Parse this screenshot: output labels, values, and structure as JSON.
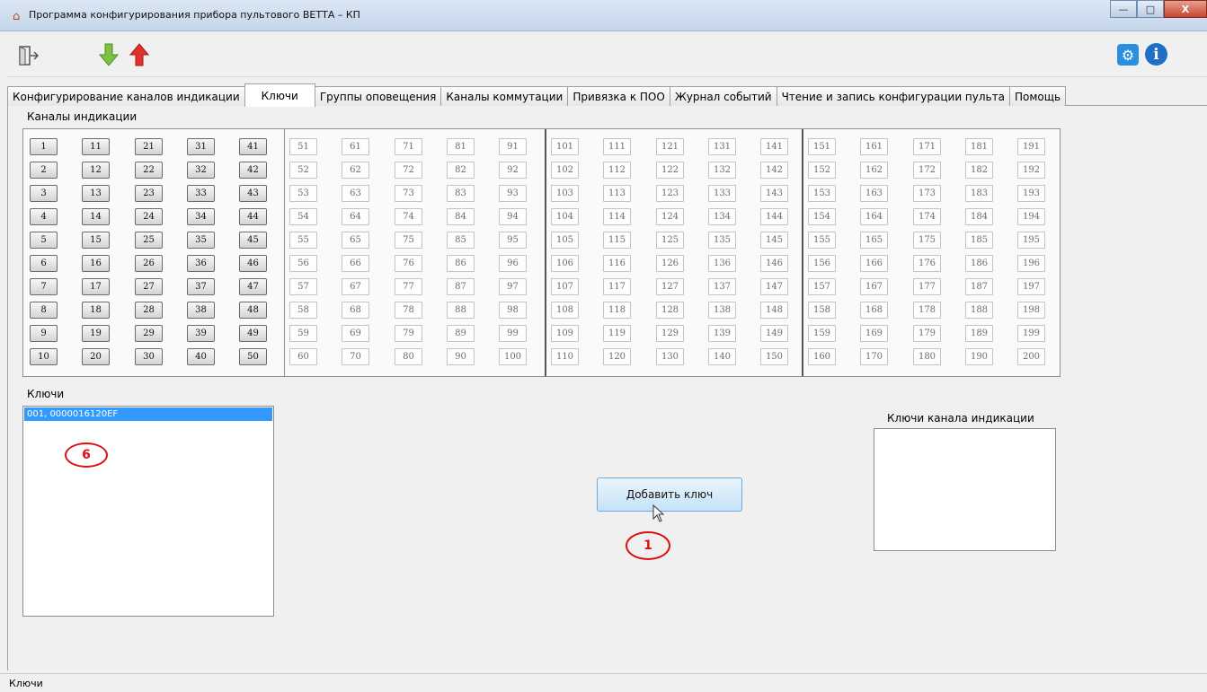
{
  "window": {
    "title": "Программа конфигурирования прибора пультового ВЕТТА – КП",
    "controls": {
      "minimize": "—",
      "maximize": "□",
      "close": "X"
    }
  },
  "toolbar": {
    "icons": [
      "exit-icon",
      "download-arrow-icon",
      "upload-arrow-icon",
      "settings-icon",
      "info-icon"
    ],
    "info_glyph": "i"
  },
  "tabs": [
    {
      "label": "Конфигурирование каналов индикации",
      "active": false
    },
    {
      "label": "Ключи",
      "active": true
    },
    {
      "label": "Группы оповещения",
      "active": false
    },
    {
      "label": "Каналы коммутации",
      "active": false
    },
    {
      "label": "Привязка к ПОО",
      "active": false
    },
    {
      "label": "Журнал событий",
      "active": false
    },
    {
      "label": "Чтение и запись конфигурации пульта",
      "active": false
    },
    {
      "label": "Помощь",
      "active": false
    }
  ],
  "channels": {
    "label": "Каналы индикации",
    "count": 200,
    "enabled_through": 50
  },
  "keys": {
    "label": "Ключи",
    "items": [
      "001, 0000016120EF"
    ]
  },
  "add_key_button": "Добавить ключ",
  "channel_keys": {
    "label": "Ключи канала индикации",
    "items": []
  },
  "annotations": [
    "6",
    "1"
  ],
  "status_bar": {
    "text": "Ключи"
  },
  "colors": {
    "selection": "#3399ff",
    "annotation": "#dd1111",
    "settings_icon": "#2b8fe0",
    "info_icon": "#1f6fc7",
    "down_arrow": "#7cc242",
    "up_arrow": "#e0322b"
  }
}
